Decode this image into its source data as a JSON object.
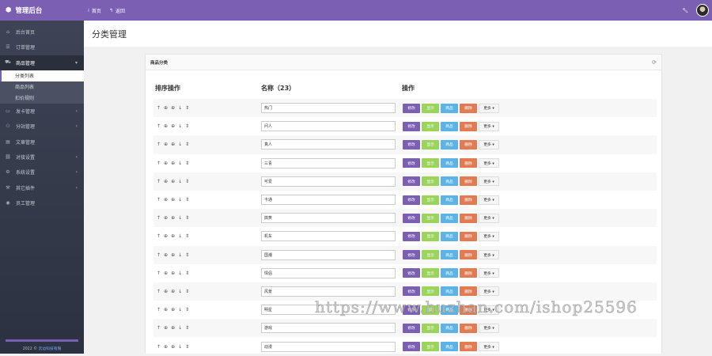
{
  "header": {
    "brand": "管理后台",
    "actions": [
      {
        "label": "首页",
        "icon": "menu-icon"
      },
      {
        "label": "返回",
        "icon": "back-arrow-icon"
      }
    ],
    "right_icons": [
      "wrench-icon",
      "avatar"
    ]
  },
  "sidebar": {
    "items": [
      {
        "label": "后台首页",
        "icon": "home-icon",
        "has_children": false
      },
      {
        "label": "订单管理",
        "icon": "list-icon",
        "has_children": false
      },
      {
        "label": "商品管理",
        "icon": "cart-icon",
        "has_children": true,
        "open": true,
        "children": [
          "分类列表",
          "商品列表",
          "扣价规则"
        ],
        "active_child": "分类列表"
      },
      {
        "label": "发卡管理",
        "icon": "card-icon",
        "has_children": true
      },
      {
        "label": "分站管理",
        "icon": "sitemap-icon",
        "has_children": true
      },
      {
        "label": "文章管理",
        "icon": "doc-icon",
        "has_children": false
      },
      {
        "label": "对接设置",
        "icon": "link-icon",
        "has_children": true
      },
      {
        "label": "系统设置",
        "icon": "gear-icon",
        "has_children": true
      },
      {
        "label": "其它插件",
        "icon": "plugin-icon",
        "has_children": true
      },
      {
        "label": "员工管理",
        "icon": "user-icon",
        "has_children": false
      }
    ],
    "footer": {
      "prefix": "2022 ©",
      "link": "云边科技有限"
    }
  },
  "page": {
    "title": "分类管理"
  },
  "panel": {
    "title": "商品分类",
    "columns": [
      "排序操作",
      "名称（23）",
      "操作"
    ],
    "order_icons": [
      "↑",
      "⊕",
      "⊕",
      "↓",
      "⇕"
    ],
    "buttons": {
      "edit": "修改",
      "show": "显示",
      "goods": "商品",
      "del": "删除",
      "more": "更多 ▾"
    },
    "rows": [
      "热门",
      "问人",
      "真人",
      "三青",
      "可爱",
      "卡通",
      "搞笑",
      "机车",
      "国潮",
      "情侣",
      "风景",
      "明星",
      "游戏",
      "动漫"
    ]
  },
  "watermark": "https://www.huzhan.com/ishop25596",
  "colors": {
    "accent": "#7b5fb3",
    "sidebar": "#3e4455",
    "show": "#9bd45c",
    "goods": "#5bb4e5",
    "del": "#e07b53"
  }
}
